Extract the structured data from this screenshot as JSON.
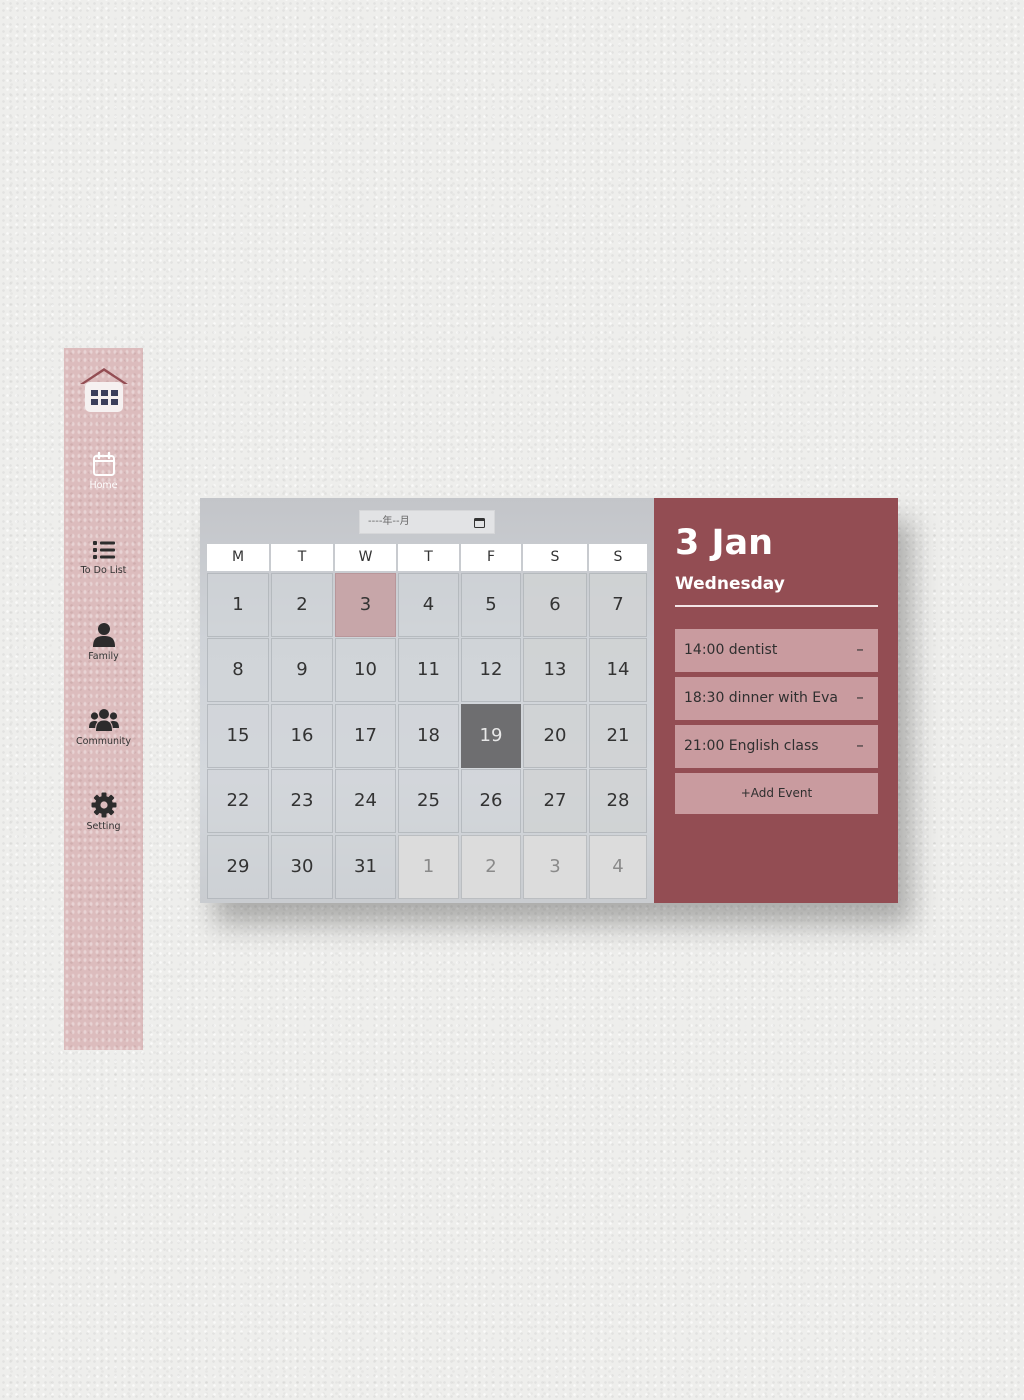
{
  "sidebar": {
    "logo_icon": "calendar-house-logo-icon",
    "items": [
      {
        "label": "Home",
        "icon": "calendar-icon",
        "active": true
      },
      {
        "label": "To Do List",
        "icon": "list-icon",
        "active": false
      },
      {
        "label": "Family",
        "icon": "user-icon",
        "active": false
      },
      {
        "label": "Community",
        "icon": "users-icon",
        "active": false
      },
      {
        "label": "Setting",
        "icon": "gear-icon",
        "active": false
      }
    ]
  },
  "calendar": {
    "month_picker_value": "----年--月",
    "weekdays": [
      "M",
      "T",
      "W",
      "T",
      "F",
      "S",
      "S"
    ],
    "days": [
      [
        "1",
        "2",
        "3",
        "4",
        "5",
        "6",
        "7"
      ],
      [
        "8",
        "9",
        "10",
        "11",
        "12",
        "13",
        "14"
      ],
      [
        "15",
        "16",
        "17",
        "18",
        "19",
        "20",
        "21"
      ],
      [
        "22",
        "23",
        "24",
        "25",
        "26",
        "27",
        "28"
      ],
      [
        "29",
        "30",
        "31",
        "1",
        "2",
        "3",
        "4"
      ]
    ],
    "selected_day": "3",
    "today_day": "19"
  },
  "events_panel": {
    "date": "3 Jan",
    "weekday": "Wednesday",
    "events": [
      {
        "text": "14:00 dentist",
        "remove": "–"
      },
      {
        "text": "18:30 dinner with Eva",
        "remove": "–"
      },
      {
        "text": "21:00 English class",
        "remove": "–"
      }
    ],
    "add_label": "+Add Event"
  },
  "colors": {
    "sidebar": "#dcbcbd",
    "event_panel": "#934d53",
    "event_item": "#c99b9f",
    "selected_day": "#c7a6a9",
    "today_day": "#6e6e70",
    "logo_roof": "#934d53"
  }
}
